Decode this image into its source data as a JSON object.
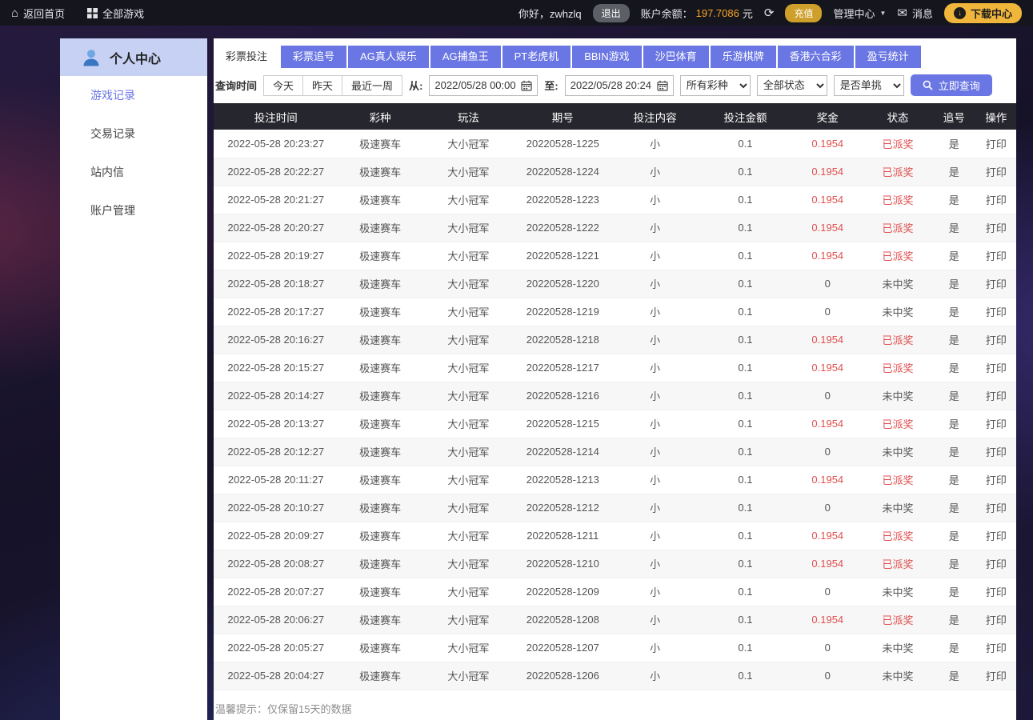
{
  "topbar": {
    "home_label": "返回首页",
    "all_games_label": "全部游戏",
    "greeting": "你好，zwhzlq",
    "logout_label": "退出",
    "balance_label": "账户余额：",
    "balance_value": "197.7086",
    "balance_unit": "元",
    "recharge_label": "充值",
    "admin_label": "管理中心",
    "messages_label": "消息",
    "download_label": "下载中心"
  },
  "sidebar": {
    "title": "个人中心",
    "items": [
      {
        "label": "游戏记录",
        "active": true
      },
      {
        "label": "交易记录",
        "active": false
      },
      {
        "label": "站内信",
        "active": false
      },
      {
        "label": "账户管理",
        "active": false
      }
    ]
  },
  "tabs": [
    {
      "label": "彩票投注",
      "active": true
    },
    {
      "label": "彩票追号",
      "active": false
    },
    {
      "label": "AG真人娱乐",
      "active": false
    },
    {
      "label": "AG捕鱼王",
      "active": false
    },
    {
      "label": "PT老虎机",
      "active": false
    },
    {
      "label": "BBIN游戏",
      "active": false
    },
    {
      "label": "沙巴体育",
      "active": false
    },
    {
      "label": "乐游棋牌",
      "active": false
    },
    {
      "label": "香港六合彩",
      "active": false
    },
    {
      "label": "盈亏统计",
      "active": false
    }
  ],
  "filters": {
    "time_label": "查询时间",
    "quick_ranges": [
      {
        "name": "today-button",
        "label": "今天"
      },
      {
        "name": "yesterday-button",
        "label": "昨天"
      },
      {
        "name": "last-week-button",
        "label": "最近一周"
      }
    ],
    "from_label": "从:",
    "from_value": "2022/05/28 00:00",
    "to_label": "至:",
    "to_value": "2022/05/28 20:24",
    "selects": [
      {
        "name": "lottery-type-select",
        "value": "所有彩种"
      },
      {
        "name": "status-select",
        "value": "全部状态"
      },
      {
        "name": "single-pick-select",
        "value": "是否单挑"
      }
    ],
    "query_label": "立即查询"
  },
  "table": {
    "headers": [
      "投注时间",
      "彩种",
      "玩法",
      "期号",
      "投注内容",
      "投注金额",
      "奖金",
      "状态",
      "追号",
      "操作"
    ],
    "rows": [
      [
        "2022-05-28 20:23:27",
        "极速赛车",
        "大小冠军",
        "20220528-1225",
        "小",
        "0.1",
        "0.1954",
        "已派奖",
        "是",
        "打印"
      ],
      [
        "2022-05-28 20:22:27",
        "极速赛车",
        "大小冠军",
        "20220528-1224",
        "小",
        "0.1",
        "0.1954",
        "已派奖",
        "是",
        "打印"
      ],
      [
        "2022-05-28 20:21:27",
        "极速赛车",
        "大小冠军",
        "20220528-1223",
        "小",
        "0.1",
        "0.1954",
        "已派奖",
        "是",
        "打印"
      ],
      [
        "2022-05-28 20:20:27",
        "极速赛车",
        "大小冠军",
        "20220528-1222",
        "小",
        "0.1",
        "0.1954",
        "已派奖",
        "是",
        "打印"
      ],
      [
        "2022-05-28 20:19:27",
        "极速赛车",
        "大小冠军",
        "20220528-1221",
        "小",
        "0.1",
        "0.1954",
        "已派奖",
        "是",
        "打印"
      ],
      [
        "2022-05-28 20:18:27",
        "极速赛车",
        "大小冠军",
        "20220528-1220",
        "小",
        "0.1",
        "0",
        "未中奖",
        "是",
        "打印"
      ],
      [
        "2022-05-28 20:17:27",
        "极速赛车",
        "大小冠军",
        "20220528-1219",
        "小",
        "0.1",
        "0",
        "未中奖",
        "是",
        "打印"
      ],
      [
        "2022-05-28 20:16:27",
        "极速赛车",
        "大小冠军",
        "20220528-1218",
        "小",
        "0.1",
        "0.1954",
        "已派奖",
        "是",
        "打印"
      ],
      [
        "2022-05-28 20:15:27",
        "极速赛车",
        "大小冠军",
        "20220528-1217",
        "小",
        "0.1",
        "0.1954",
        "已派奖",
        "是",
        "打印"
      ],
      [
        "2022-05-28 20:14:27",
        "极速赛车",
        "大小冠军",
        "20220528-1216",
        "小",
        "0.1",
        "0",
        "未中奖",
        "是",
        "打印"
      ],
      [
        "2022-05-28 20:13:27",
        "极速赛车",
        "大小冠军",
        "20220528-1215",
        "小",
        "0.1",
        "0.1954",
        "已派奖",
        "是",
        "打印"
      ],
      [
        "2022-05-28 20:12:27",
        "极速赛车",
        "大小冠军",
        "20220528-1214",
        "小",
        "0.1",
        "0",
        "未中奖",
        "是",
        "打印"
      ],
      [
        "2022-05-28 20:11:27",
        "极速赛车",
        "大小冠军",
        "20220528-1213",
        "小",
        "0.1",
        "0.1954",
        "已派奖",
        "是",
        "打印"
      ],
      [
        "2022-05-28 20:10:27",
        "极速赛车",
        "大小冠军",
        "20220528-1212",
        "小",
        "0.1",
        "0",
        "未中奖",
        "是",
        "打印"
      ],
      [
        "2022-05-28 20:09:27",
        "极速赛车",
        "大小冠军",
        "20220528-1211",
        "小",
        "0.1",
        "0.1954",
        "已派奖",
        "是",
        "打印"
      ],
      [
        "2022-05-28 20:08:27",
        "极速赛车",
        "大小冠军",
        "20220528-1210",
        "小",
        "0.1",
        "0.1954",
        "已派奖",
        "是",
        "打印"
      ],
      [
        "2022-05-28 20:07:27",
        "极速赛车",
        "大小冠军",
        "20220528-1209",
        "小",
        "0.1",
        "0",
        "未中奖",
        "是",
        "打印"
      ],
      [
        "2022-05-28 20:06:27",
        "极速赛车",
        "大小冠军",
        "20220528-1208",
        "小",
        "0.1",
        "0.1954",
        "已派奖",
        "是",
        "打印"
      ],
      [
        "2022-05-28 20:05:27",
        "极速赛车",
        "大小冠军",
        "20220528-1207",
        "小",
        "0.1",
        "0",
        "未中奖",
        "是",
        "打印"
      ],
      [
        "2022-05-28 20:04:27",
        "极速赛车",
        "大小冠军",
        "20220528-1206",
        "小",
        "0.1",
        "0",
        "未中奖",
        "是",
        "打印"
      ]
    ]
  },
  "footer_note": "温馨提示：仅保留15天的数据",
  "colors": {
    "accent": "#6a76e3",
    "status_red": "#e04f4f",
    "balance_orange": "#f8a525",
    "gold": "#f0b63c",
    "table_header_bg": "#26262e",
    "sidebar_header_bg": "#c6d1f3",
    "topbar_bg": "#15151d"
  }
}
